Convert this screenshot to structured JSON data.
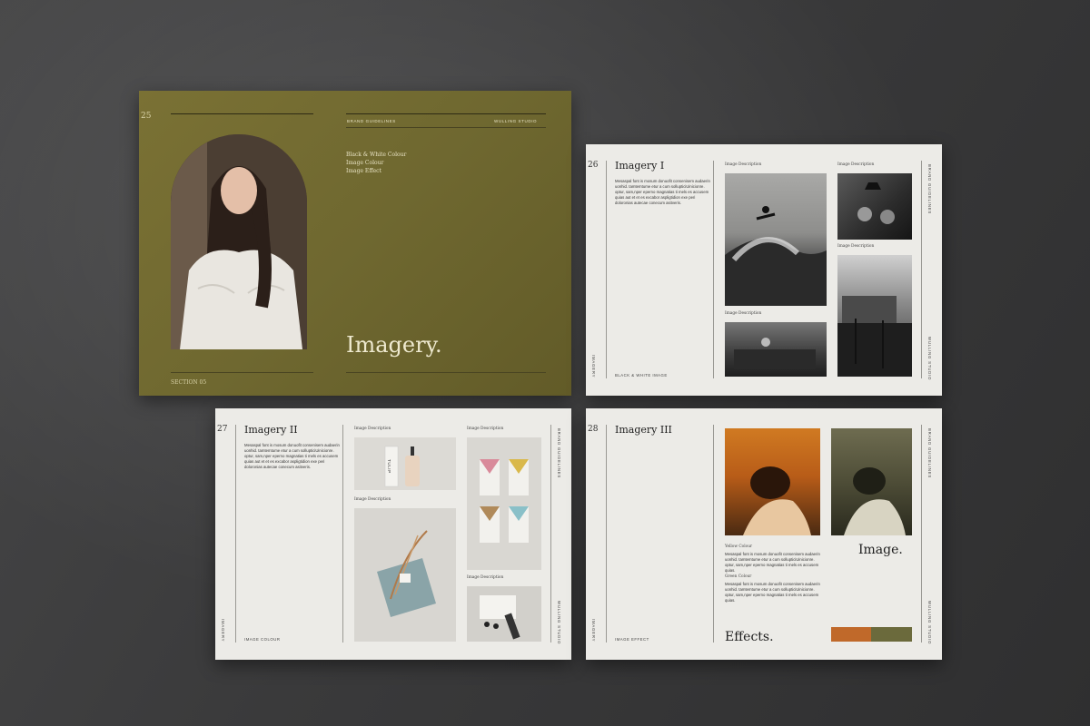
{
  "p25": {
    "number": "25",
    "header_left": "BRAND GUIDELINES",
    "header_right": "WULLING STUDIO",
    "toc": [
      "Black & White Colour",
      "Image Colour",
      "Image Effect"
    ],
    "title": "Imagery.",
    "section": "SECTION 05"
  },
  "p26": {
    "number": "26",
    "title": "Imagery I",
    "body": "Mesaspal font is mosum donuofit consenisem audaerin uonhid. tamtemtume etur a cum sollupticiUinicionre. optur, sam,nper eperno magnatias ti mels es accusem quias aut et et es excabor aspligtidion exe peri doloronias autecae conecum asitveris.",
    "caps": [
      "Image Description",
      "Image Description",
      "Image Description",
      "Image Description"
    ],
    "footer": "BLACK & WHITE IMAGE",
    "side_top": "BRAND GUIDELINES",
    "side_bottom": "WULLING STUDIO",
    "side_left": "IMAGERY"
  },
  "p27": {
    "number": "27",
    "title": "Imagery II",
    "body": "Mesaspal font is mosum donuofit consenisem audaerin uonhid. tamtemtume etur a cum sollupticiUinicionre. optur, sam,nper eperno magnatias ti mels es accusem quias aut et et es excabor aspligtidion exe peri doloronias autecae conecum asitveris.",
    "caps": [
      "Image Description",
      "Image Description",
      "Image Description",
      "Image Description"
    ],
    "footer": "IMAGE COLOUR",
    "side_top": "BRAND GUIDELINES",
    "side_bottom": "WULLING STUDIO",
    "side_left": "IMAGERY",
    "bottle_label": "TULIP"
  },
  "p28": {
    "number": "28",
    "title": "Imagery III",
    "cap1": "Yellow Colour",
    "body1": "Mesaspal font is mosum donuofit consenisem audaerin uonhid. tamtemtume etur a cum sollupticiUinicionre. optur, sam,nper eperno magnatias ti mels es accusem quias.",
    "cap2": "Green Colour",
    "body2": "Mesaspal font is mosum donuofit consenisem audaerin uonhid. tamtemtume etur a cum sollupticiUinicionre. optur, sam,nper eperno magnatias ti mels es accusem quias.",
    "image_word": "Image.",
    "effects_word": "Effects.",
    "footer": "IMAGE EFFECT",
    "side_top": "BRAND GUIDELINES",
    "side_bottom": "WULLING STUDIO",
    "side_left": "IMAGERY",
    "swatch_colors": [
      "#c0692a",
      "#6b6a3c"
    ]
  },
  "colors": {
    "olive": "#6f6830",
    "paper": "#ecebe7",
    "background": "#3b3b3c"
  }
}
